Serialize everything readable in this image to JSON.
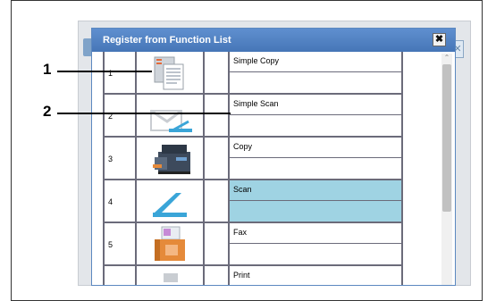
{
  "dialog": {
    "title": "Register from Function List",
    "close_label": "✖"
  },
  "callouts": [
    "1",
    "2"
  ],
  "rows": [
    {
      "number": "1",
      "name": "Simple Copy",
      "icon": "simple-copy-icon"
    },
    {
      "number": "2",
      "name": "Simple Scan",
      "icon": "simple-scan-icon"
    },
    {
      "number": "3",
      "name": "Copy",
      "icon": "copy-icon"
    },
    {
      "number": "4",
      "name": "Scan",
      "icon": "scan-icon",
      "selected": true
    },
    {
      "number": "5",
      "name": "Fax",
      "icon": "fax-icon"
    },
    {
      "number": "",
      "name": "Print",
      "icon": "print-icon"
    }
  ],
  "colors": {
    "titlebar": "#5585c6",
    "selected_row": "#9fd3e3",
    "grid_line": "#6b6b7a"
  }
}
